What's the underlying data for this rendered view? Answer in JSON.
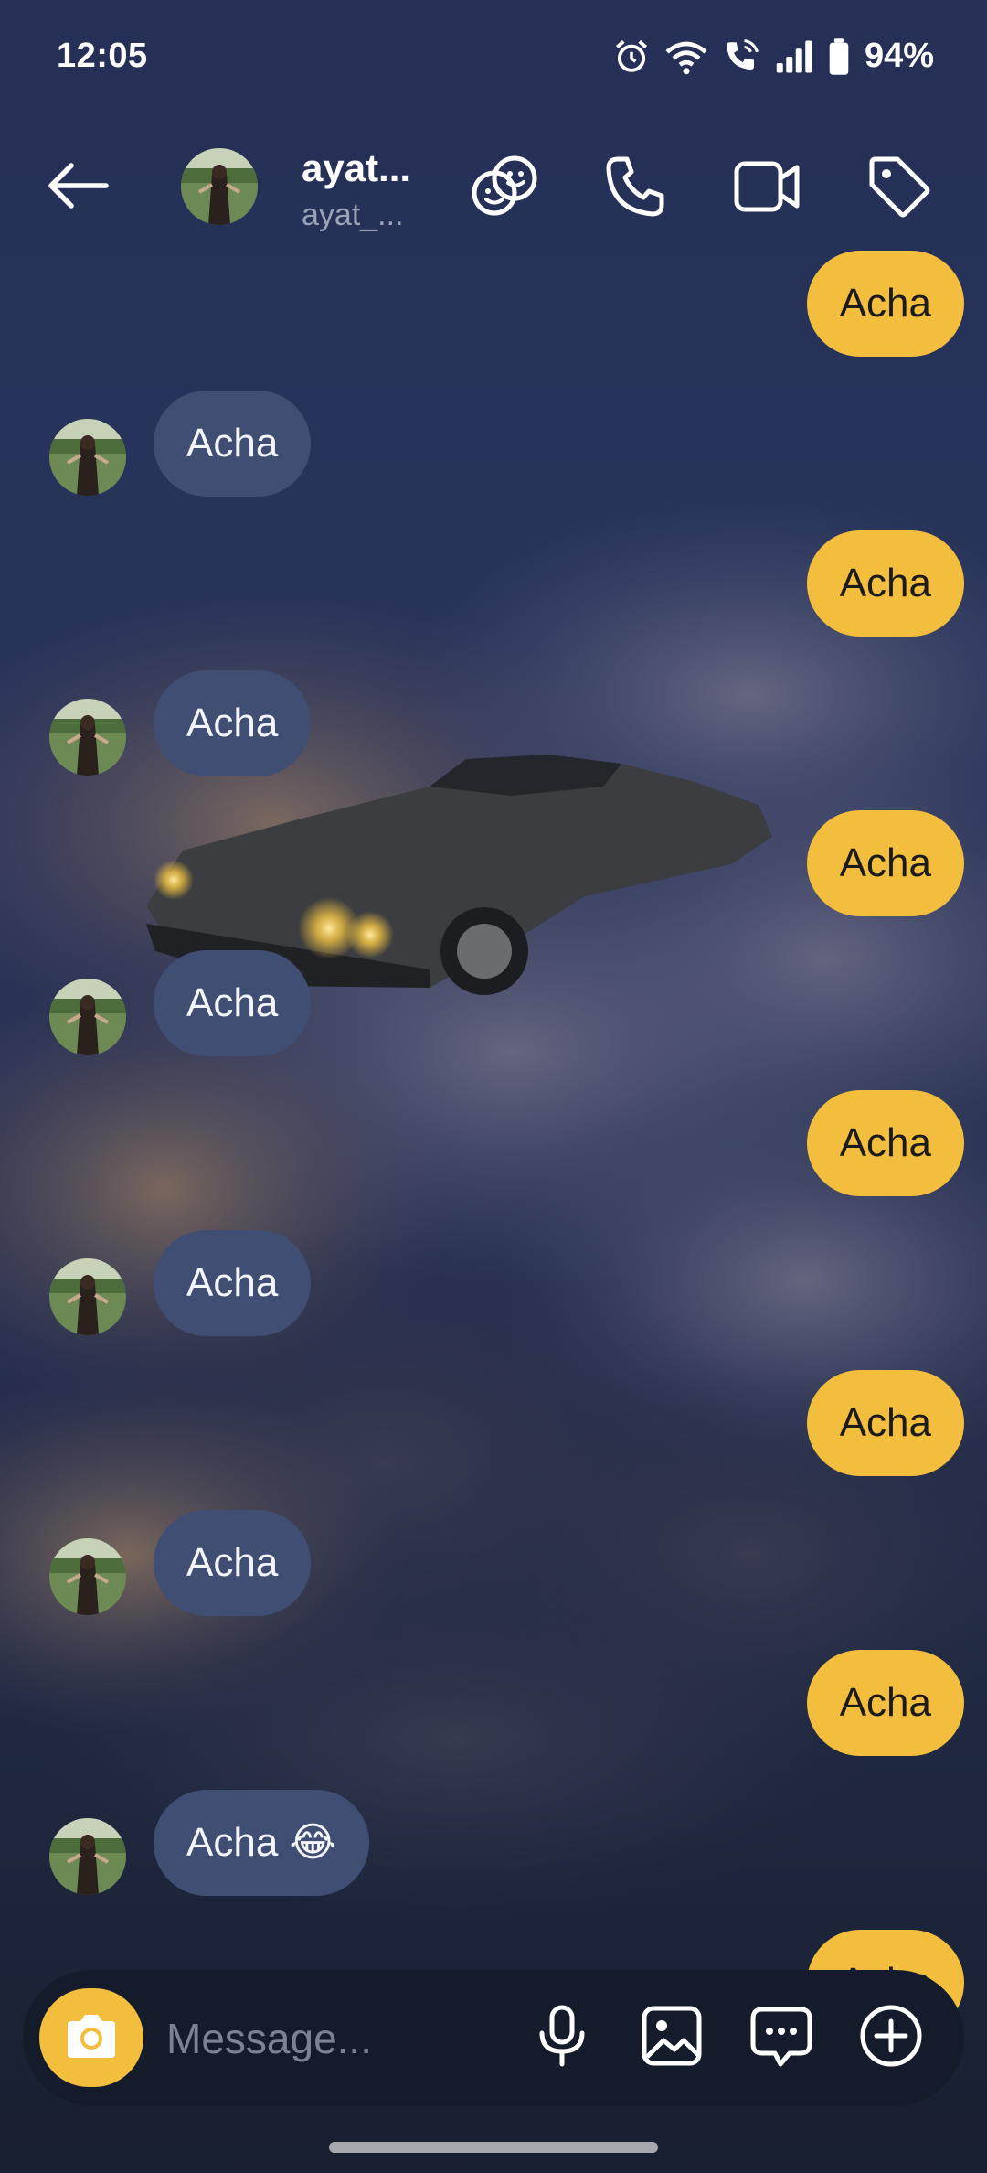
{
  "status_bar": {
    "time": "12:05",
    "battery": "94%",
    "icons": [
      "alarm-icon",
      "wifi-icon",
      "wifi-calling-icon",
      "signal-icon",
      "battery-icon"
    ]
  },
  "header": {
    "back_icon": "arrow-left-icon",
    "name": "ayat...",
    "username": "ayat_...",
    "actions": [
      "friendship-icon",
      "phone-icon",
      "video-icon",
      "tag-icon"
    ]
  },
  "messages": [
    {
      "direction": "out",
      "text": "Acha"
    },
    {
      "direction": "in",
      "text": "Acha"
    },
    {
      "direction": "out",
      "text": "Acha"
    },
    {
      "direction": "in",
      "text": "Acha"
    },
    {
      "direction": "out",
      "text": "Acha"
    },
    {
      "direction": "in",
      "text": "Acha"
    },
    {
      "direction": "out",
      "text": "Acha"
    },
    {
      "direction": "in",
      "text": "Acha"
    },
    {
      "direction": "out",
      "text": "Acha"
    },
    {
      "direction": "in",
      "text": "Acha"
    },
    {
      "direction": "out",
      "text": "Acha"
    },
    {
      "direction": "in",
      "text": "Acha 😂"
    },
    {
      "direction": "out",
      "text": "Acha"
    }
  ],
  "composer": {
    "placeholder": "Message...",
    "icons": [
      "camera-icon",
      "microphone-icon",
      "image-icon",
      "sticker-chat-icon",
      "plus-circle-icon"
    ]
  },
  "colors": {
    "outgoing_bubble": "#f3be3d",
    "incoming_bubble": "#3f4e72",
    "accent": "#f3be3d"
  }
}
